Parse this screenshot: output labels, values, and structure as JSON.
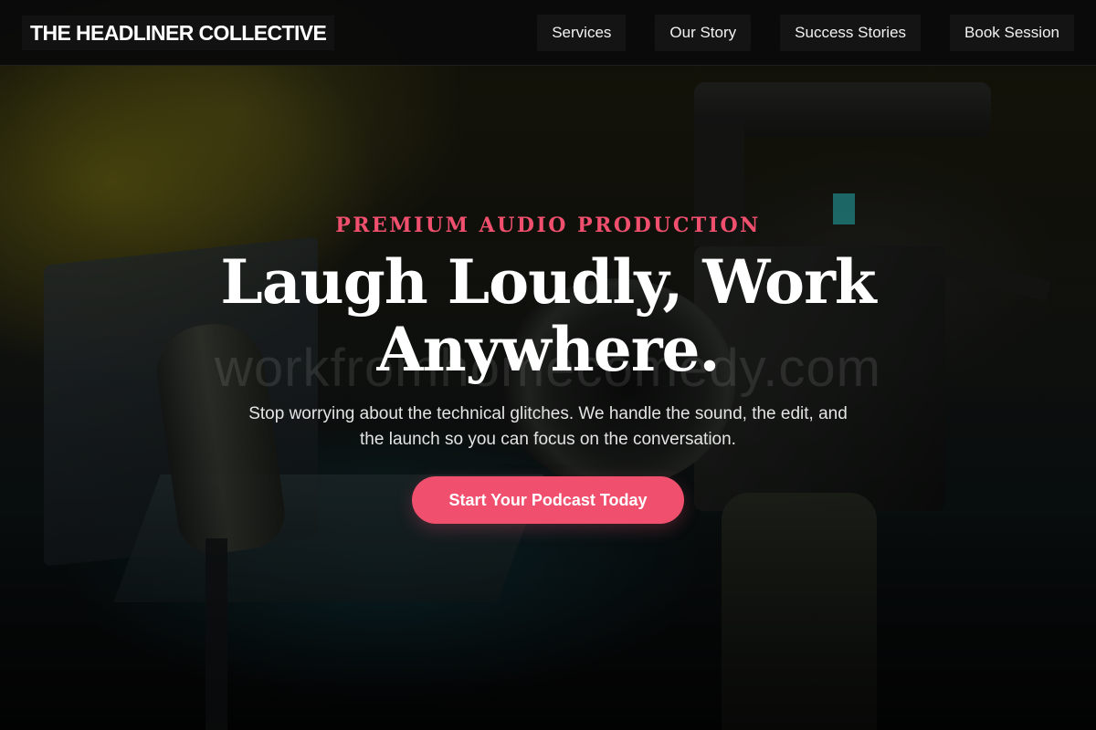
{
  "header": {
    "brand": "THE HEADLINER COLLECTIVE",
    "nav": [
      {
        "label": "Services"
      },
      {
        "label": "Our Story"
      },
      {
        "label": "Success Stories"
      },
      {
        "label": "Book Session"
      }
    ]
  },
  "hero": {
    "eyebrow": "PREMIUM AUDIO PRODUCTION",
    "headline_line1": "Laugh Loudly, Work",
    "headline_line2": "Anywhere.",
    "subtext": "Stop worrying about the technical glitches. We handle the sound, the edit, and the launch so you can focus on the conversation.",
    "cta_label": "Start Your Podcast Today",
    "watermark": "workfromhomecomedy.com",
    "background_image": "podcast studio with microphone, laptop and Canon camera"
  },
  "colors": {
    "accent": "#f0506e",
    "header_bg": "#0a0a0a",
    "nav_bg": "#141414",
    "text_primary": "#ffffff"
  }
}
